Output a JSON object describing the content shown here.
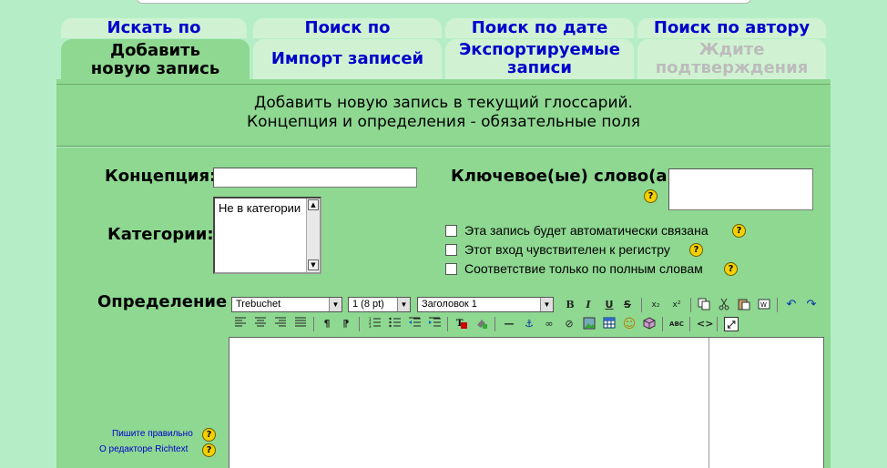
{
  "tabs_row1": [
    {
      "label": "Искать по алфавиту"
    },
    {
      "label": "Поиск по категории"
    },
    {
      "label": "Поиск по дате"
    },
    {
      "label": "Поиск по автору"
    }
  ],
  "tabs_row2": [
    {
      "label": "Добавить новую запись",
      "state": "active"
    },
    {
      "label": "Импорт записей",
      "state": "normal"
    },
    {
      "label": "Экспортируемые записи",
      "state": "normal"
    },
    {
      "label": "Ждите подтверждения",
      "state": "disabled"
    }
  ],
  "intro": {
    "line1": "Добавить новую запись в текущий глоссарий.",
    "line2": "Концепция и определения - обязательные поля"
  },
  "form": {
    "concept_label": "Концепция:",
    "concept_value": "",
    "keywords_label": "Ключевое(ые) слово(а):",
    "keywords_value": "",
    "categories_label": "Категории:",
    "categories_options": [
      "Не в категории"
    ],
    "checkboxes": [
      {
        "label": "Эта запись будет автоматически связана",
        "checked": false
      },
      {
        "label": "Этот вход чувствителен к регистру",
        "checked": false
      },
      {
        "label": "Соответствие только по полным словам",
        "checked": false
      }
    ],
    "definition_label": "Определение:",
    "help_glyph": "?"
  },
  "editor": {
    "font_family": "Trebuchet",
    "font_size": "1 (8 pt)",
    "paragraph": "Заголовок 1",
    "buttons_row1": [
      "bold-icon",
      "italic-icon",
      "underline-icon",
      "strikethrough-icon",
      "subscript-icon",
      "superscript-icon",
      "copy-icon",
      "cut-icon",
      "paste-icon",
      "clean-word-icon",
      "undo-icon",
      "redo-icon"
    ],
    "buttons_row2": [
      "justify-left-icon",
      "justify-center-icon",
      "justify-right-icon",
      "justify-full-icon",
      "ltr-icon",
      "rtl-icon",
      "ordered-list-icon",
      "unordered-list-icon",
      "outdent-icon",
      "indent-icon",
      "text-color-icon",
      "bg-color-icon",
      "horizontal-rule-icon",
      "anchor-icon",
      "link-icon",
      "unlink-icon",
      "image-icon",
      "table-icon",
      "smiley-icon",
      "special-char-icon",
      "spellcheck-icon",
      "html-source-icon",
      "fullscreen-icon"
    ],
    "glyphs": {
      "bold": "B",
      "italic": "I",
      "underline": "U",
      "strike": "S",
      "sub": "x₂",
      "sup": "x²",
      "undo": "↶",
      "redo": "↷",
      "ltr": "¶",
      "rtl": "¶",
      "hr": "—",
      "anchor": "⚓",
      "link": "∞",
      "unlink": "⊘",
      "smiley": "☺",
      "html": "<>",
      "fullscreen": "⤢",
      "spell": "ABC"
    }
  },
  "help_links": {
    "write_correctly": "Пишите правильно",
    "about_editor": "О редакторе Richtext"
  },
  "colors": {
    "page_bg": "#b5eec6",
    "panel_bg": "#8ed891",
    "tab_bg": "#d0f2d2",
    "link": "#0000cc",
    "help_icon": "#f5d000"
  }
}
